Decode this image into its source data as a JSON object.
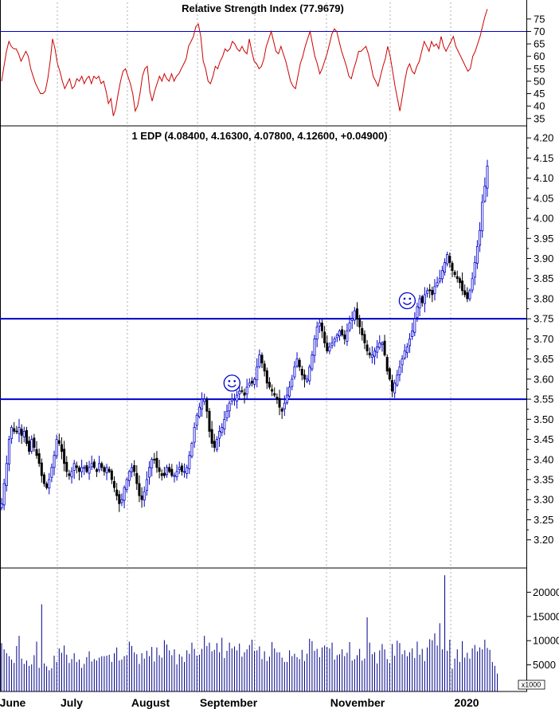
{
  "colors": {
    "rsi_line": "#cc0000",
    "ref_line": "#0000cc",
    "candle_up": "#0000cc",
    "candle_down": "#000000",
    "volume": "#00008b",
    "grid": "#999999",
    "smiley": "#0000cc"
  },
  "chart_data": [
    {
      "type": "line",
      "title": "Relative Strength Index (77.9679)",
      "ylim": [
        33,
        82
      ],
      "yticks": [
        "75",
        "70",
        "65",
        "60",
        "55",
        "50",
        "45",
        "40",
        "35"
      ],
      "reference_line": 70,
      "series": [
        {
          "values": [
            50,
            56,
            62,
            66,
            64,
            63,
            63,
            61,
            58,
            60,
            62,
            60,
            55,
            52,
            49,
            47,
            45,
            45,
            46,
            51,
            58,
            67,
            63,
            57,
            54,
            50,
            47,
            49,
            51,
            47,
            48,
            51,
            50,
            52,
            49,
            51,
            52,
            49,
            52,
            51,
            52,
            49,
            50,
            46,
            41,
            43,
            36,
            39,
            45,
            50,
            54,
            55,
            52,
            49,
            45,
            38,
            40,
            45,
            52,
            55,
            56,
            46,
            42,
            46,
            49,
            52,
            50,
            53,
            51,
            50,
            53,
            50,
            52,
            53,
            55,
            57,
            59,
            64,
            66,
            68,
            72,
            73,
            68,
            58,
            55,
            50,
            49,
            52,
            56,
            55,
            58,
            60,
            63,
            62,
            63,
            66,
            65,
            63,
            62,
            64,
            62,
            61,
            67,
            62,
            58,
            57,
            55,
            56,
            59,
            64,
            67,
            70,
            66,
            62,
            61,
            64,
            61,
            58,
            54,
            50,
            48,
            47,
            52,
            57,
            60,
            64,
            67,
            70,
            65,
            60,
            57,
            53,
            55,
            58,
            61,
            65,
            69,
            71,
            70,
            66,
            62,
            59,
            56,
            52,
            51,
            55,
            58,
            62,
            62,
            63,
            64,
            61,
            57,
            52,
            50,
            48,
            52,
            56,
            59,
            64,
            60,
            54,
            48,
            43,
            38,
            44,
            50,
            55,
            57,
            54,
            53,
            56,
            58,
            62,
            66,
            64,
            62,
            66,
            64,
            65,
            63,
            68,
            64,
            62,
            64,
            66,
            68,
            64,
            62,
            60,
            58,
            56,
            54,
            55,
            60,
            62,
            65,
            68,
            72,
            76,
            79
          ]
        }
      ]
    },
    {
      "type": "candlestick",
      "title": "1 EDP (4.08400, 4.16300, 4.07800, 4.12600, +0.04900)",
      "ylim": [
        3.13,
        4.23
      ],
      "yticks": [
        "4.20",
        "4.15",
        "4.10",
        "4.05",
        "4.00",
        "3.95",
        "3.90",
        "3.85",
        "3.80",
        "3.75",
        "3.70",
        "3.65",
        "3.60",
        "3.55",
        "3.50",
        "3.45",
        "3.40",
        "3.35",
        "3.30",
        "3.25",
        "3.20"
      ],
      "reference_lines": [
        3.75,
        3.55
      ],
      "smiley_annotations": [
        {
          "x": 92,
          "y": 3.59
        },
        {
          "x": 162,
          "y": 3.795
        }
      ],
      "x_labels": [
        "June",
        "July",
        "August",
        "September",
        "November",
        "2020"
      ],
      "close_series": [
        3.29,
        3.34,
        3.39,
        3.45,
        3.48,
        3.47,
        3.47,
        3.48,
        3.46,
        3.47,
        3.44,
        3.42,
        3.45,
        3.43,
        3.41,
        3.39,
        3.36,
        3.34,
        3.33,
        3.35,
        3.38,
        3.41,
        3.45,
        3.44,
        3.42,
        3.39,
        3.37,
        3.36,
        3.37,
        3.39,
        3.38,
        3.37,
        3.38,
        3.38,
        3.37,
        3.38,
        3.39,
        3.38,
        3.37,
        3.39,
        3.38,
        3.37,
        3.38,
        3.37,
        3.35,
        3.33,
        3.31,
        3.29,
        3.3,
        3.33,
        3.35,
        3.37,
        3.38,
        3.37,
        3.34,
        3.31,
        3.3,
        3.32,
        3.35,
        3.38,
        3.4,
        3.4,
        3.38,
        3.37,
        3.36,
        3.36,
        3.38,
        3.37,
        3.36,
        3.36,
        3.37,
        3.38,
        3.37,
        3.37,
        3.38,
        3.41,
        3.44,
        3.48,
        3.51,
        3.53,
        3.55,
        3.55,
        3.52,
        3.47,
        3.44,
        3.43,
        3.45,
        3.47,
        3.48,
        3.5,
        3.52,
        3.54,
        3.55,
        3.55,
        3.56,
        3.57,
        3.57,
        3.56,
        3.58,
        3.59,
        3.59,
        3.6,
        3.63,
        3.66,
        3.64,
        3.62,
        3.59,
        3.58,
        3.57,
        3.56,
        3.55,
        3.53,
        3.52,
        3.54,
        3.56,
        3.58,
        3.6,
        3.63,
        3.65,
        3.63,
        3.61,
        3.6,
        3.6,
        3.63,
        3.66,
        3.7,
        3.73,
        3.74,
        3.72,
        3.69,
        3.67,
        3.68,
        3.69,
        3.7,
        3.71,
        3.72,
        3.71,
        3.7,
        3.72,
        3.74,
        3.75,
        3.77,
        3.75,
        3.73,
        3.71,
        3.69,
        3.67,
        3.66,
        3.66,
        3.67,
        3.68,
        3.69,
        3.69,
        3.66,
        3.62,
        3.6,
        3.57,
        3.59,
        3.61,
        3.63,
        3.65,
        3.67,
        3.68,
        3.7,
        3.72,
        3.75,
        3.78,
        3.8,
        3.79,
        3.81,
        3.82,
        3.82,
        3.81,
        3.83,
        3.84,
        3.85,
        3.87,
        3.89,
        3.91,
        3.89,
        3.87,
        3.86,
        3.85,
        3.84,
        3.82,
        3.81,
        3.8,
        3.82,
        3.85,
        3.89,
        3.93,
        3.97,
        4.04,
        4.08,
        4.13
      ]
    },
    {
      "type": "bar",
      "title": "",
      "ylim": [
        0,
        25000
      ],
      "yticks": [
        "20000",
        "15000",
        "10000",
        "5000"
      ],
      "unit_label": "x1000",
      "values": [
        9500,
        8200,
        7400,
        6800,
        6100,
        5400,
        8900,
        11000,
        6300,
        5200,
        5900,
        4800,
        5100,
        7000,
        9800,
        4400,
        17500,
        5300,
        4700,
        3900,
        4300,
        6900,
        5600,
        8400,
        7500,
        9000,
        7100,
        5400,
        6200,
        7400,
        5600,
        6100,
        4400,
        5200,
        6600,
        7800,
        5700,
        6200,
        5900,
        6500,
        6800,
        6800,
        6900,
        7100,
        5600,
        7400,
        8600,
        5900,
        6100,
        6800,
        7000,
        9800,
        8900,
        7600,
        7200,
        5200,
        7400,
        6300,
        7900,
        6800,
        8700,
        5700,
        8600,
        7000,
        6500,
        10100,
        9200,
        8000,
        7000,
        8200,
        5100,
        7200,
        6700,
        5600,
        8000,
        7300,
        9600,
        8300,
        6900,
        7100,
        8300,
        11000,
        8900,
        9600,
        7800,
        8100,
        9500,
        7600,
        10600,
        6400,
        7900,
        9600,
        8400,
        8800,
        8000,
        9400,
        6700,
        7600,
        8200,
        9100,
        10200,
        7900,
        8000,
        8800,
        6200,
        7800,
        5800,
        6700,
        9700,
        8400,
        7600,
        7600,
        6500,
        5600,
        5600,
        8000,
        6800,
        7300,
        6600,
        6200,
        8100,
        5800,
        7300,
        10400,
        9900,
        7900,
        8300,
        6600,
        8600,
        9000,
        8700,
        8400,
        9600,
        6100,
        7000,
        7200,
        8200,
        6800,
        7500,
        9700,
        5900,
        6200,
        7000,
        8300,
        5900,
        6300,
        14800,
        9600,
        7200,
        7600,
        5300,
        8000,
        9300,
        8200,
        6200,
        5400,
        9300,
        6900,
        10000,
        9500,
        7200,
        8000,
        6800,
        7600,
        8400,
        6400,
        9800,
        7100,
        8300,
        5800,
        8600,
        10300,
        10100,
        11500,
        9000,
        13600,
        8200,
        23500,
        7900,
        10200,
        4200,
        6300,
        8200,
        5600,
        9900,
        6500,
        7500,
        6300,
        8400,
        9100,
        7800,
        8600,
        8200,
        10200,
        8500,
        8100,
        5600,
        4800,
        3200
      ]
    }
  ]
}
